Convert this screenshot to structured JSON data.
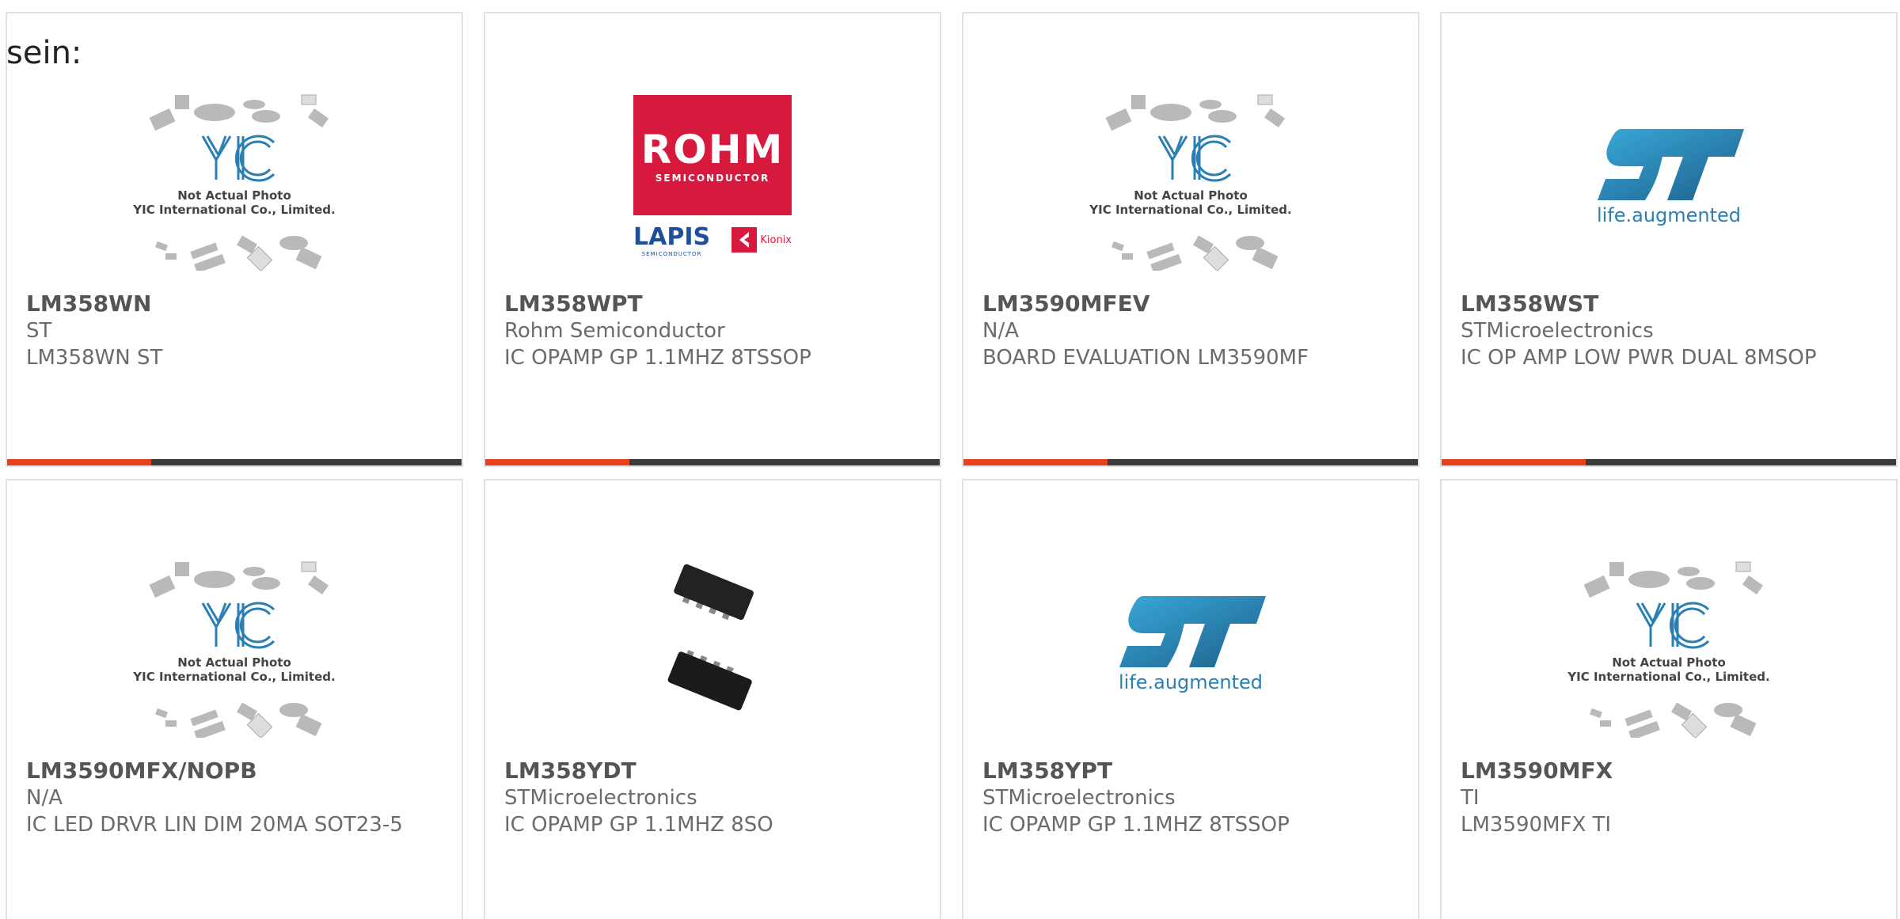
{
  "prefix_text": "sein:",
  "placeholder": {
    "line1": "Not Actual Photo",
    "line2": "YIC International Co., Limited."
  },
  "rohm_logo": {
    "main": "ROHM",
    "sub": "SEMICONDUCTOR",
    "lapis": "LAPIS",
    "lapis_sub": "SEMICONDUCTOR",
    "kionix": "Kionix"
  },
  "st_logo": {
    "tagline": "life.augmented"
  },
  "colors": {
    "accent": "#e8401c",
    "bar": "#3b3b3b",
    "rohm_red": "#d7193e",
    "st_blue": "#2a7fb5"
  },
  "products": [
    {
      "part": "LM358WN",
      "maker": "ST",
      "desc": "LM358WN ST",
      "image": "yic-placeholder"
    },
    {
      "part": "LM358WPT",
      "maker": "Rohm Semiconductor",
      "desc": "IC OPAMP GP 1.1MHZ 8TSSOP",
      "image": "rohm-logo"
    },
    {
      "part": "LM3590MFEV",
      "maker": "N/A",
      "desc": "BOARD EVALUATION LM3590MF",
      "image": "yic-placeholder"
    },
    {
      "part": "LM358WST",
      "maker": "STMicroelectronics",
      "desc": "IC OP AMP LOW PWR DUAL 8MSOP",
      "image": "st-logo"
    },
    {
      "part": "LM3590MFX/NOPB",
      "maker": "N/A",
      "desc": "IC LED DRVR LIN DIM 20MA SOT23-5",
      "image": "yic-placeholder"
    },
    {
      "part": "LM358YDT",
      "maker": "STMicroelectronics",
      "desc": "IC OPAMP GP 1.1MHZ 8SO",
      "image": "chip-photo"
    },
    {
      "part": "LM358YPT",
      "maker": "STMicroelectronics",
      "desc": "IC OPAMP GP 1.1MHZ 8TSSOP",
      "image": "st-logo"
    },
    {
      "part": "LM3590MFX",
      "maker": "TI",
      "desc": "LM3590MFX TI",
      "image": "yic-placeholder"
    }
  ]
}
